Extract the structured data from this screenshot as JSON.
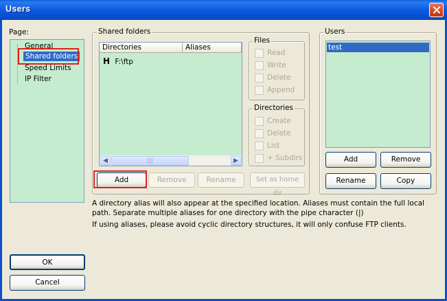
{
  "window": {
    "title": "Users"
  },
  "page_group": {
    "label": "Page:",
    "items": [
      "General",
      "Shared folders",
      "Speed Limits",
      "IP Filter"
    ]
  },
  "shared_folders": {
    "label": "Shared folders",
    "columns": [
      "Directories",
      "Aliases"
    ],
    "rows": [
      {
        "marker": "H",
        "directory": "F:\\ftp"
      }
    ],
    "scroll_grip": "|||"
  },
  "files_group": {
    "label": "Files",
    "options": [
      "Read",
      "Write",
      "Delete",
      "Append"
    ]
  },
  "dirs_group": {
    "label": "Directories",
    "options": [
      "Create",
      "Delete",
      "List",
      "+ Subdirs"
    ]
  },
  "folder_buttons": {
    "add": "Add",
    "remove": "Remove",
    "rename": "Rename",
    "set_home": "Set as home dir"
  },
  "users_group": {
    "label": "Users",
    "users": [
      "test"
    ],
    "add": "Add",
    "remove": "Remove",
    "rename": "Rename",
    "copy": "Copy"
  },
  "info": {
    "line1": "A directory alias will also appear at the specified location. Aliases must contain the full local",
    "line2": "path. Separate multiple aliases for one directory with the pipe character (|)",
    "line3": "If using aliases, please avoid cyclic directory structures, it will only confuse FTP clients."
  },
  "dialog_buttons": {
    "ok": "OK",
    "cancel": "Cancel"
  },
  "colors": {
    "list_bg": "#c5ecce",
    "selection": "#316ac5",
    "highlight_box": "#e02020"
  }
}
